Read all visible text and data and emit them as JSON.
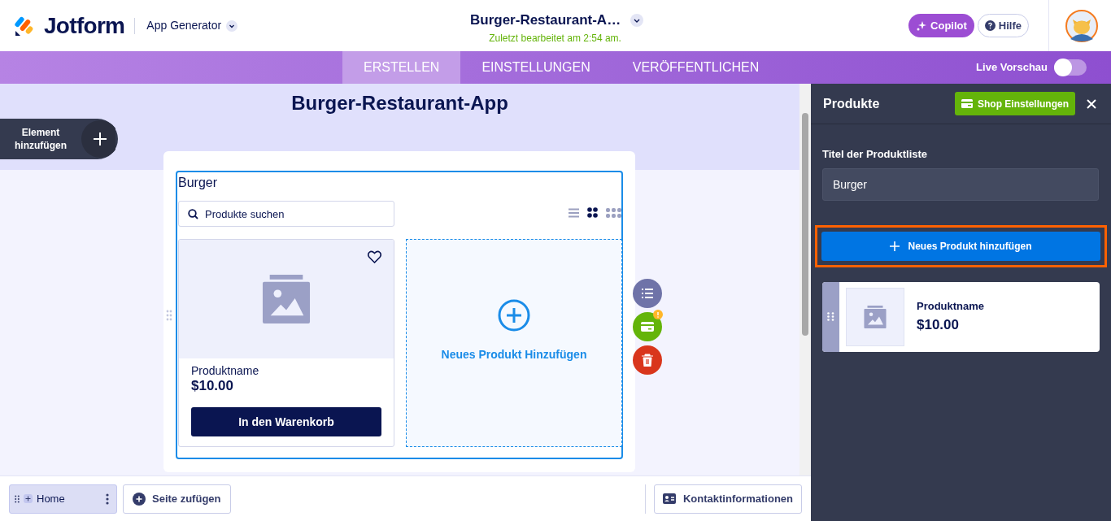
{
  "header": {
    "logo": "Jotform",
    "app_switcher": "App Generator",
    "document_title": "Burger-Restaurant-A…",
    "last_edited": "Zuletzt bearbeitet am 2:54 am.",
    "buttons": [
      {
        "kind": "copilot",
        "label": "Copilot"
      },
      {
        "kind": "help",
        "label": "Hilfe"
      }
    ]
  },
  "tabs": [
    {
      "label": "ERSTELLEN",
      "selected": true
    },
    {
      "label": "EINSTELLUNGEN",
      "selected": false
    },
    {
      "label": "VERÖFFENTLICHEN",
      "selected": false
    }
  ],
  "live_preview": {
    "label": "Live Vorschau",
    "on": false
  },
  "canvas": {
    "app_title": "Burger-Restaurant-App",
    "add_element": "Element hinzufügen",
    "product_list": {
      "title": "Burger",
      "search_placeholder": "Produkte suchen",
      "view_modes": [
        {
          "kind": "list",
          "selected": false
        },
        {
          "kind": "grid",
          "selected": true
        },
        {
          "kind": "compact",
          "selected": false
        }
      ],
      "products": [
        {
          "name": "Produktname",
          "price": "$10.00",
          "button": "In den Warenkorb"
        }
      ],
      "add_card": "Neues Produkt Hinzufügen"
    },
    "side_actions": [
      {
        "kind": "list",
        "color": "#6f73a8",
        "badge": false
      },
      {
        "kind": "payment",
        "color": "#64b40a",
        "badge": true
      },
      {
        "kind": "delete",
        "color": "#d9361c",
        "badge": false
      }
    ]
  },
  "panel": {
    "title": "Produkte",
    "shop_button": "Shop Einstellungen",
    "field_label": "Titel der Produktliste",
    "field_value": "Burger",
    "add_button": {
      "label": "Neues Produkt hinzufügen",
      "highlighted": true
    },
    "products": [
      {
        "name": "Produktname",
        "price": "$10.00"
      }
    ]
  },
  "bottom_bar": {
    "pages": [
      {
        "label": "Home",
        "selected": true
      }
    ],
    "add_page": "Seite zufügen",
    "contact": "Kontaktinformationen"
  }
}
